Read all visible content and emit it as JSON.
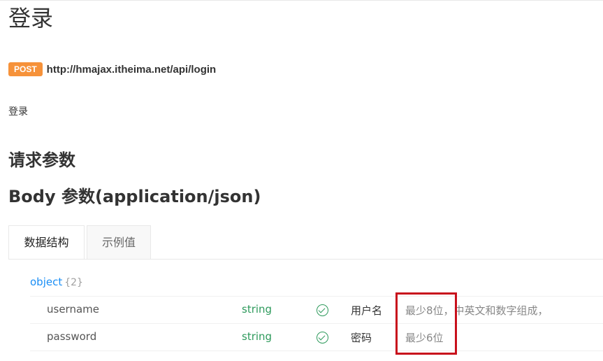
{
  "title": "登录",
  "endpoint": {
    "method": "POST",
    "url": "http://hmajax.itheima.net/api/login"
  },
  "description": "登录",
  "request_params_title": "请求参数",
  "body_title": "Body 参数(application/json)",
  "tabs": [
    {
      "label": "数据结构",
      "active": true
    },
    {
      "label": "示例值",
      "active": false
    }
  ],
  "schema": {
    "root_type": "object",
    "root_count": "{2}",
    "fields": [
      {
        "name": "username",
        "type": "string",
        "required": true,
        "label": "用户名",
        "desc_highlight": "最少8位",
        "desc_rest": "，中英文和数字组成，"
      },
      {
        "name": "password",
        "type": "string",
        "required": true,
        "label": "密码",
        "desc_highlight": "最少6位",
        "desc_rest": ""
      }
    ]
  },
  "colors": {
    "method_badge": "#f6923a",
    "type_color": "#2e9a5c",
    "link_blue": "#1a8ef5",
    "highlight_border": "#c8101c"
  }
}
